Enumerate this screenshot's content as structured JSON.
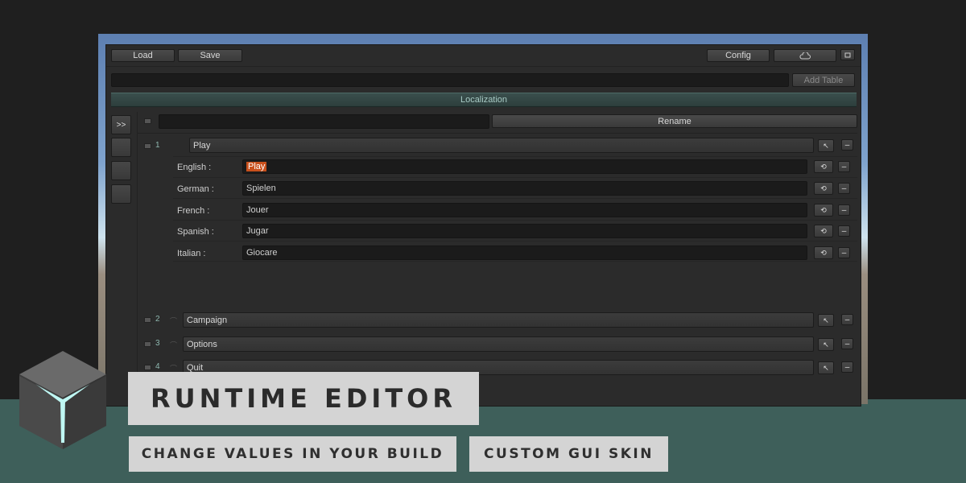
{
  "toolbar": {
    "load_label": "Load",
    "save_label": "Save",
    "config_label": "Config",
    "cloud_icon": "cloud-icon",
    "window_icon": "window-icon"
  },
  "table_bar": {
    "add_table_label": "Add Table",
    "table_name_value": ""
  },
  "section_title": "Localization",
  "sidebar": {
    "expand_label": ">>"
  },
  "rename_bar": {
    "name_value": "",
    "rename_label": "Rename"
  },
  "entries": [
    {
      "index": "1",
      "key": "Play",
      "expanded": true,
      "languages": [
        {
          "label": "English :",
          "value": "Play",
          "selected": true
        },
        {
          "label": "German :",
          "value": "Spielen"
        },
        {
          "label": "French :",
          "value": "Jouer"
        },
        {
          "label": "Spanish :",
          "value": "Jugar"
        },
        {
          "label": "Italian :",
          "value": "Giocare"
        }
      ]
    },
    {
      "index": "2",
      "key": "Campaign",
      "expanded": false
    },
    {
      "index": "3",
      "key": "Options",
      "expanded": false
    },
    {
      "index": "4",
      "key": "Quit",
      "expanded": false
    }
  ],
  "icons": {
    "refresh": "refresh-icon",
    "cursor": "cursor-icon",
    "remove": "–"
  },
  "banner": {
    "title": "RUNTIME EDITOR",
    "tag1": "CHANGE VALUES IN YOUR BUILD",
    "tag2": "CUSTOM GUI SKIN"
  },
  "colors": {
    "accent_teal": "#3e5f5a",
    "selection_orange": "#c8501c",
    "panel_bg": "#2b2b2b"
  }
}
